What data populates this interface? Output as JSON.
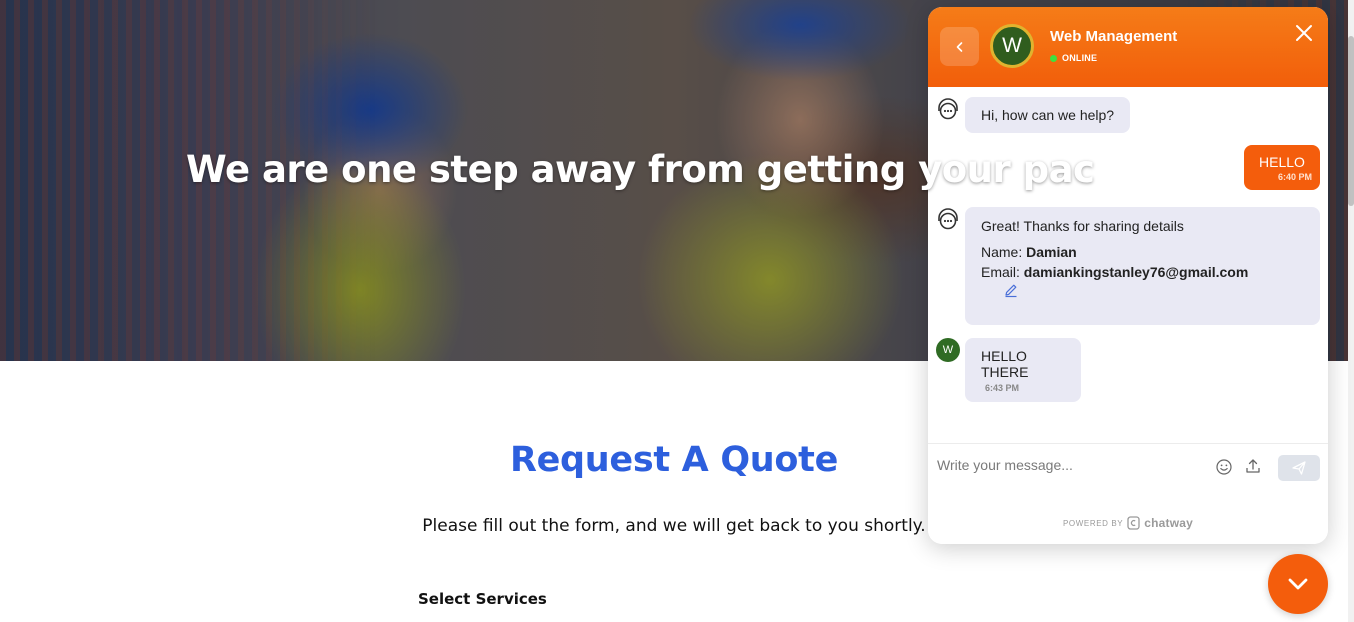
{
  "hero": {
    "title": "We are one step away from getting your pac"
  },
  "page": {
    "heading": "Request A Quote",
    "subtitle": "Please fill out the form, and we will get back to you shortly.",
    "services_label": "Select Services"
  },
  "chat": {
    "agent_name": "Web Management",
    "avatar_initial": "W",
    "status": "ONLINE",
    "accent_color": "#f45d0c",
    "status_color": "#3fe03f",
    "icons": [
      "chevron-left-icon",
      "close-icon",
      "support-bot-icon",
      "edit-icon",
      "emoji-icon",
      "upload-icon",
      "send-icon",
      "chevron-down-icon"
    ],
    "messages": {
      "greeting": "Hi, how can we help?",
      "user_hello": {
        "text": "HELLO",
        "time": "6:40 PM"
      },
      "thanks": {
        "text": "Great! Thanks for sharing details",
        "name_label": "Name:",
        "name_value": "Damian",
        "email_label": "Email:",
        "email_value": "damiankingstanley76@gmail.com"
      },
      "agent_reply": {
        "text": "HELLO THERE",
        "time": "6:43 PM"
      }
    },
    "composer": {
      "placeholder": "Write your message..."
    },
    "footer": {
      "powered_by": "POWERED BY",
      "brand": "chatway"
    }
  }
}
